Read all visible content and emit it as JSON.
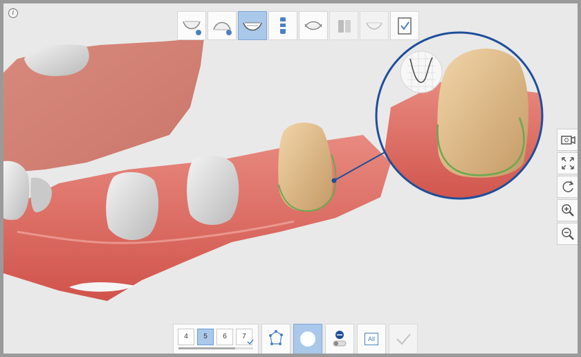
{
  "colors": {
    "accent": "#a9c8ea",
    "accent_border": "#7fa7d6",
    "margin_line": "#6aa84f",
    "callout": "#1f4e9a"
  },
  "info_icon": "i",
  "workflow_steps": [
    {
      "name": "step-upper-jaw-scan",
      "icon": "upper-jaw-icon",
      "active": false
    },
    {
      "name": "step-lower-jaw-scan",
      "icon": "lower-jaw-icon",
      "active": false
    },
    {
      "name": "step-margin-line",
      "icon": "jaw-margin-icon",
      "active": true
    },
    {
      "name": "step-scan-body",
      "icon": "scan-body-icon",
      "active": false
    },
    {
      "name": "step-bite-alignment",
      "icon": "bite-icon",
      "active": false
    },
    {
      "name": "step-implant",
      "icon": "implant-icon",
      "active": false
    },
    {
      "name": "step-design",
      "icon": "tooth-outline-icon",
      "active": false
    },
    {
      "name": "step-finish",
      "icon": "checklist-icon",
      "active": false
    }
  ],
  "side_tools": [
    "camera-icon",
    "fit-screen-icon",
    "rotate-icon",
    "zoom-in-icon",
    "zoom-out-icon"
  ],
  "tooth_numbers": [
    "4",
    "5",
    "6",
    "7"
  ],
  "selected_tooth": "5",
  "bottom_tools": {
    "polygon_label": "polygon-tool-icon",
    "circle_label": "circle-tool-icon",
    "erase_label": "erase-toggle-icon",
    "all_label": "All",
    "confirm_label": "checkmark-icon"
  }
}
